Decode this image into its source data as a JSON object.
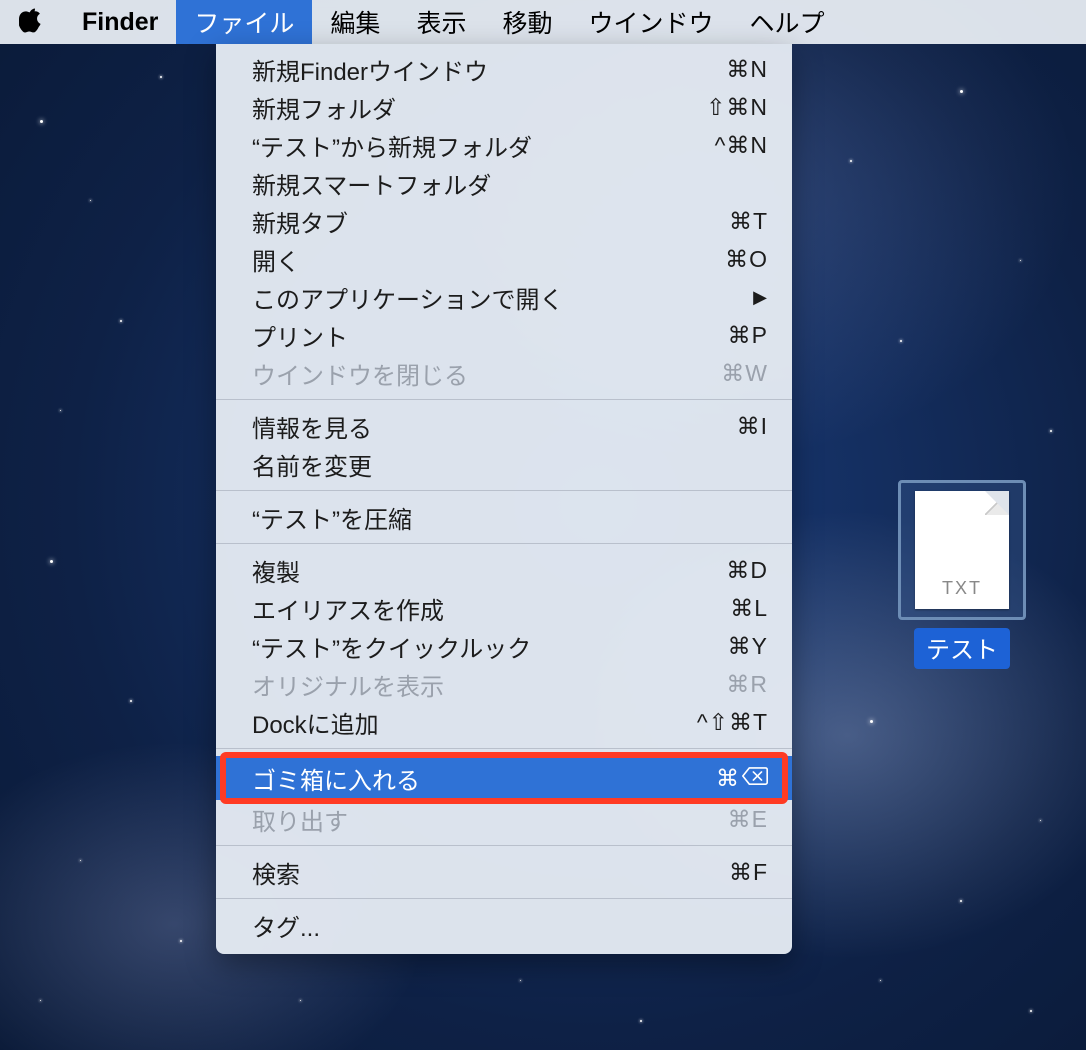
{
  "menubar": {
    "app_name": "Finder",
    "items": [
      {
        "label": "ファイル",
        "active": true
      },
      {
        "label": "編集"
      },
      {
        "label": "表示"
      },
      {
        "label": "移動"
      },
      {
        "label": "ウインドウ"
      },
      {
        "label": "ヘルプ"
      }
    ]
  },
  "dropdown": {
    "groups": [
      [
        {
          "label": "新規Finderウインドウ",
          "shortcut": "⌘N"
        },
        {
          "label": "新規フォルダ",
          "shortcut": "⇧⌘N"
        },
        {
          "label": "“テスト”から新規フォルダ",
          "shortcut": "^⌘N"
        },
        {
          "label": "新規スマートフォルダ",
          "shortcut": ""
        },
        {
          "label": "新規タブ",
          "shortcut": "⌘T"
        },
        {
          "label": "開く",
          "shortcut": "⌘O"
        },
        {
          "label": "このアプリケーションで開く",
          "shortcut": "",
          "submenu": true
        },
        {
          "label": "プリント",
          "shortcut": "⌘P"
        },
        {
          "label": "ウインドウを閉じる",
          "shortcut": "⌘W",
          "disabled": true
        }
      ],
      [
        {
          "label": "情報を見る",
          "shortcut": "⌘I"
        },
        {
          "label": "名前を変更",
          "shortcut": ""
        }
      ],
      [
        {
          "label": "“テスト”を圧縮",
          "shortcut": ""
        }
      ],
      [
        {
          "label": "複製",
          "shortcut": "⌘D"
        },
        {
          "label": "エイリアスを作成",
          "shortcut": "⌘L"
        },
        {
          "label": "“テスト”をクイックルック",
          "shortcut": "⌘Y"
        },
        {
          "label": "オリジナルを表示",
          "shortcut": "⌘R",
          "disabled": true
        },
        {
          "label": "Dockに追加",
          "shortcut": "^⇧⌘T"
        }
      ],
      [
        {
          "label": "ゴミ箱に入れる",
          "shortcut": "⌘",
          "delete_key": true,
          "highlight": true,
          "annotated": true
        },
        {
          "label": "取り出す",
          "shortcut": "⌘E",
          "disabled": true
        }
      ],
      [
        {
          "label": "検索",
          "shortcut": "⌘F"
        }
      ],
      [
        {
          "label": "タグ...",
          "shortcut": ""
        }
      ]
    ]
  },
  "desktop_file": {
    "ext": "TXT",
    "name": "テスト"
  }
}
